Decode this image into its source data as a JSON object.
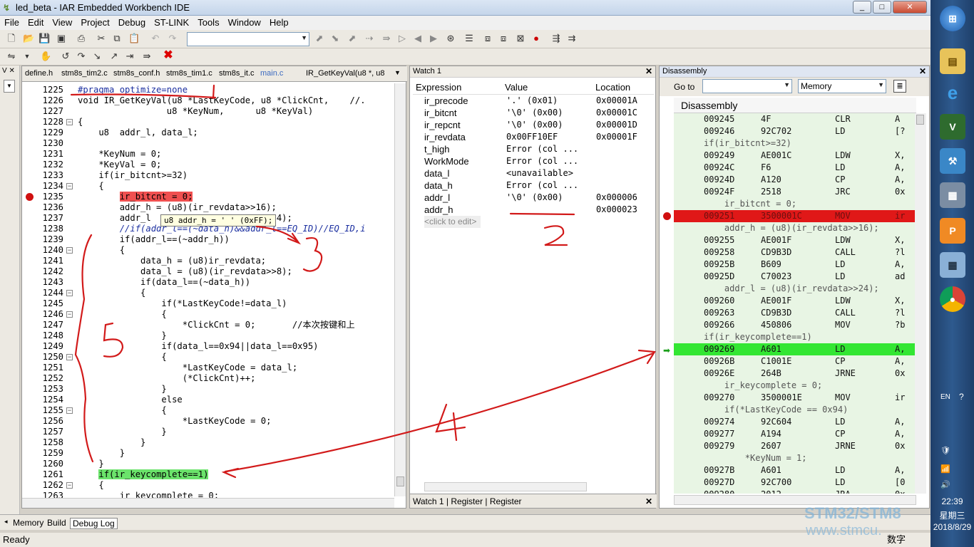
{
  "window": {
    "title": "led_beta - IAR Embedded Workbench IDE",
    "minimize": "_",
    "maximize": "□",
    "close": "✕"
  },
  "menu": [
    "File",
    "Edit",
    "View",
    "Project",
    "Debug",
    "ST-LINK",
    "Tools",
    "Window",
    "Help"
  ],
  "editor": {
    "tabs": [
      "define.h",
      "stm8s_tim2.c",
      "stm8s_conf.h",
      "stm8s_tim1.c",
      "stm8s_it.c",
      "main.c"
    ],
    "function_combo": "IR_GetKeyVal(u8 *, u8",
    "tooltip": "u8 addr_h = '  ' (0xFF);",
    "lines": [
      {
        "n": "1225",
        "t": "#pragma optimize=none"
      },
      {
        "n": "1226",
        "t": "void IR_GetKeyVal(u8 *LastKeyCode, u8 *ClickCnt,    //."
      },
      {
        "n": "1227",
        "t": "                 u8 *KeyNum,      u8 *KeyVal)"
      },
      {
        "n": "1228",
        "t": "{"
      },
      {
        "n": "1229",
        "t": "    u8  addr_l, data_l;"
      },
      {
        "n": "1230",
        "t": ""
      },
      {
        "n": "1231",
        "t": "    *KeyNum = 0;"
      },
      {
        "n": "1232",
        "t": "    *KeyVal = 0;"
      },
      {
        "n": "1233",
        "t": "    if(ir_bitcnt>=32)"
      },
      {
        "n": "1234",
        "t": "    {"
      },
      {
        "n": "1235",
        "t": "        ir_bitcnt = 0;"
      },
      {
        "n": "1236",
        "t": "        addr_h = (u8)(ir_revdata>>16);"
      },
      {
        "n": "1237",
        "t": "        addr_l                     >>24);"
      },
      {
        "n": "1238",
        "t": "        //if(addr_l==(~data_h)&&addr_l==EQ_ID)//EQ_ID,i"
      },
      {
        "n": "1239",
        "t": "        if(addr_l==(~addr_h))"
      },
      {
        "n": "1240",
        "t": "        {"
      },
      {
        "n": "1241",
        "t": "            data_h = (u8)ir_revdata;"
      },
      {
        "n": "1242",
        "t": "            data_l = (u8)(ir_revdata>>8);"
      },
      {
        "n": "1243",
        "t": "            if(data_l==(~data_h))"
      },
      {
        "n": "1244",
        "t": "            {"
      },
      {
        "n": "1245",
        "t": "                if(*LastKeyCode!=data_l)"
      },
      {
        "n": "1246",
        "t": "                {"
      },
      {
        "n": "1247",
        "t": "                    *ClickCnt = 0;       //本次按键和上"
      },
      {
        "n": "1248",
        "t": "                }"
      },
      {
        "n": "1249",
        "t": "                if(data_l==0x94||data_l==0x95)"
      },
      {
        "n": "1250",
        "t": "                {"
      },
      {
        "n": "1251",
        "t": "                    *LastKeyCode = data_l;"
      },
      {
        "n": "1252",
        "t": "                    (*ClickCnt)++;"
      },
      {
        "n": "1253",
        "t": "                }"
      },
      {
        "n": "1254",
        "t": "                else"
      },
      {
        "n": "1255",
        "t": "                {"
      },
      {
        "n": "1256",
        "t": "                    *LastKeyCode = 0;"
      },
      {
        "n": "1257",
        "t": "                }"
      },
      {
        "n": "1258",
        "t": "            }"
      },
      {
        "n": "1259",
        "t": "        }"
      },
      {
        "n": "1260",
        "t": "    }"
      },
      {
        "n": "1261",
        "t": "    if(ir_keycomplete==1)"
      },
      {
        "n": "1262",
        "t": "    {"
      },
      {
        "n": "1263",
        "t": "        ir_keycomplete = 0;"
      }
    ]
  },
  "watch": {
    "title": "Watch 1",
    "headers": [
      "Expression",
      "Value",
      "Location"
    ],
    "rows": [
      {
        "e": "ir_precode",
        "v": "'.' (0x01)",
        "l": "0x00001A"
      },
      {
        "e": "ir_bitcnt",
        "v": "'\\0' (0x00)",
        "l": "0x00001C"
      },
      {
        "e": "ir_repcnt",
        "v": "'\\0' (0x00)",
        "l": "0x00001D"
      },
      {
        "e": "ir_revdata",
        "v": "0x00FF10EF",
        "l": "0x00001F"
      },
      {
        "e": "t_high",
        "v": "Error (col ...",
        "l": ""
      },
      {
        "e": "WorkMode",
        "v": "Error (col ...",
        "l": ""
      },
      {
        "e": "data_l",
        "v": "<unavailable>",
        "l": ""
      },
      {
        "e": "data_h",
        "v": "Error (col ...",
        "l": ""
      },
      {
        "e": "addr_l",
        "v": "'\\0' (0x00)",
        "l": "0x000006"
      },
      {
        "e": "addr_h",
        "v": "",
        "l": "0x000023"
      }
    ],
    "click_to_edit": "<click to edit>",
    "tabs": [
      "Watch 1",
      "Register",
      "Register"
    ]
  },
  "disassembly": {
    "title": "Disassembly",
    "goto_label": "Go to",
    "memory_combo": "Memory",
    "header": "Disassembly",
    "rows": [
      {
        "k": "i",
        "a": "009245",
        "b": "4F",
        "m": "CLR",
        "o": "A"
      },
      {
        "k": "i",
        "a": "009246",
        "b": "92C702",
        "m": "LD",
        "o": "[?"
      },
      {
        "k": "s",
        "s": "if(ir_bitcnt>=32)"
      },
      {
        "k": "i",
        "a": "009249",
        "b": "AE001C",
        "m": "LDW",
        "o": "X,"
      },
      {
        "k": "i",
        "a": "00924C",
        "b": "F6",
        "m": "LD",
        "o": "A,"
      },
      {
        "k": "i",
        "a": "00924D",
        "b": "A120",
        "m": "CP",
        "o": "A,"
      },
      {
        "k": "i",
        "a": "00924F",
        "b": "2518",
        "m": "JRC",
        "o": "0x"
      },
      {
        "k": "s",
        "s": "    ir_bitcnt = 0;"
      },
      {
        "k": "r",
        "a": "009251",
        "b": "3500001C",
        "m": "MOV",
        "o": "ir"
      },
      {
        "k": "s",
        "s": "    addr_h = (u8)(ir_revdata>>16);"
      },
      {
        "k": "i",
        "a": "009255",
        "b": "AE001F",
        "m": "LDW",
        "o": "X,"
      },
      {
        "k": "i",
        "a": "009258",
        "b": "CD9B3D",
        "m": "CALL",
        "o": "?l"
      },
      {
        "k": "i",
        "a": "00925B",
        "b": "B609",
        "m": "LD",
        "o": "A,"
      },
      {
        "k": "i",
        "a": "00925D",
        "b": "C70023",
        "m": "LD",
        "o": "ad"
      },
      {
        "k": "s",
        "s": "    addr_l = (u8)(ir_revdata>>24);"
      },
      {
        "k": "i",
        "a": "009260",
        "b": "AE001F",
        "m": "LDW",
        "o": "X,"
      },
      {
        "k": "i",
        "a": "009263",
        "b": "CD9B3D",
        "m": "CALL",
        "o": "?l"
      },
      {
        "k": "i",
        "a": "009266",
        "b": "450806",
        "m": "MOV",
        "o": "?b"
      },
      {
        "k": "s",
        "s": "if(ir_keycomplete==1)"
      },
      {
        "k": "g",
        "a": "009269",
        "b": "A601",
        "m": "LD",
        "o": "A,"
      },
      {
        "k": "i",
        "a": "00926B",
        "b": "C1001E",
        "m": "CP",
        "o": "A,"
      },
      {
        "k": "i",
        "a": "00926E",
        "b": "264B",
        "m": "JRNE",
        "o": "0x"
      },
      {
        "k": "s",
        "s": "    ir_keycomplete = 0;"
      },
      {
        "k": "i",
        "a": "009270",
        "b": "3500001E",
        "m": "MOV",
        "o": "ir"
      },
      {
        "k": "s",
        "s": "    if(*LastKeyCode == 0x94)"
      },
      {
        "k": "i",
        "a": "009274",
        "b": "92C604",
        "m": "LD",
        "o": "A,"
      },
      {
        "k": "i",
        "a": "009277",
        "b": "A194",
        "m": "CP",
        "o": "A,"
      },
      {
        "k": "i",
        "a": "009279",
        "b": "2607",
        "m": "JRNE",
        "o": "0x"
      },
      {
        "k": "s",
        "s": "        *KeyNum = 1;"
      },
      {
        "k": "i",
        "a": "00927B",
        "b": "A601",
        "m": "LD",
        "o": "A,"
      },
      {
        "k": "i",
        "a": "00927D",
        "b": "92C700",
        "m": "LD",
        "o": "[0"
      },
      {
        "k": "i",
        "a": "009280",
        "b": "2012",
        "m": "JRA",
        "o": "0x"
      }
    ]
  },
  "bottom_tabs": [
    "Memory",
    "Build",
    "Debug Log"
  ],
  "status": {
    "left": "Ready",
    "ime": "数字"
  },
  "taskbar": {
    "lang": "EN",
    "time": "22:39",
    "weekday": "星期三",
    "date": "2018/8/29"
  },
  "watermark": {
    "line1": "STM32/STM8",
    "line2": "www.stmcu."
  },
  "annotations": [
    "1",
    "2",
    "3",
    "4",
    "5"
  ],
  "colors": {
    "breakpoint": "#d01010",
    "current": "#33e633",
    "annotation": "#d21a1a"
  }
}
